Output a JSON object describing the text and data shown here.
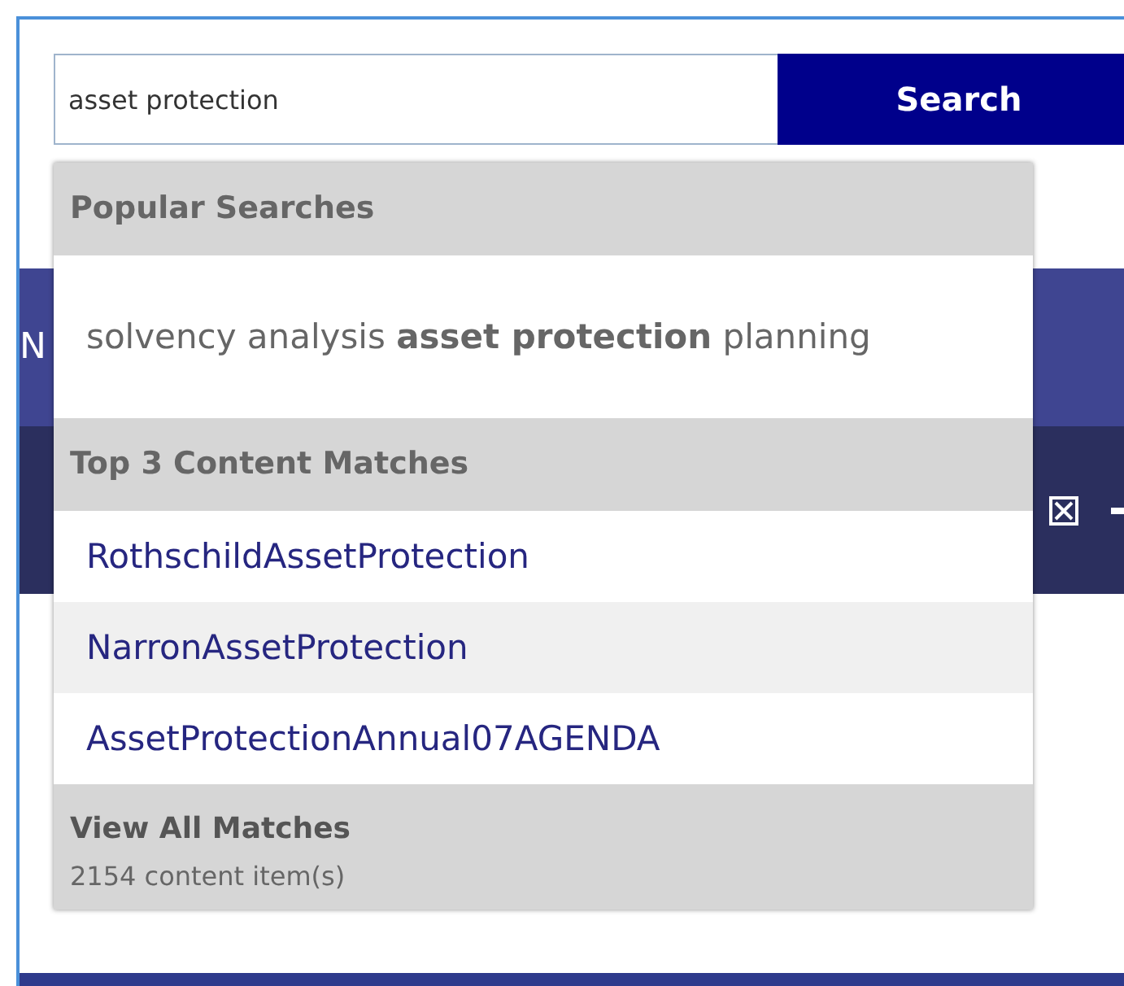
{
  "search": {
    "value": "asset protection",
    "button": "Search"
  },
  "background": {
    "nav_fragment": "N"
  },
  "dropdown": {
    "sections": [
      {
        "heading": "Popular Searches",
        "items": [
          {
            "kind": "query",
            "text": "solvency analysis **asset protection** planning",
            "selected": false
          }
        ]
      },
      {
        "heading": "Top 3 Content Matches",
        "items": [
          {
            "kind": "link",
            "text": "RothschildAssetProtection",
            "selected": false
          },
          {
            "kind": "link",
            "text": "NarronAssetProtection",
            "selected": true
          },
          {
            "kind": "link",
            "text": "AssetProtectionAnnual07AGENDA",
            "selected": false
          }
        ]
      }
    ],
    "footer": {
      "title": "View All Matches",
      "count": "2154 content item(s)"
    }
  }
}
